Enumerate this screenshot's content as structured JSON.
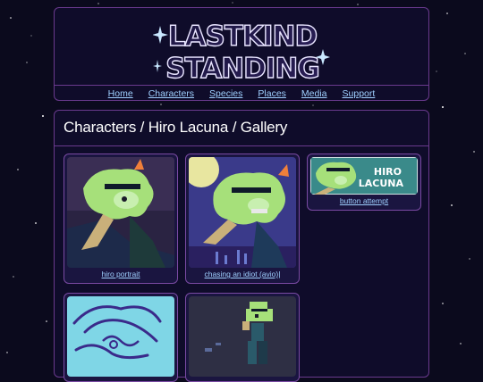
{
  "site": {
    "logo_text_line1": "LASTKIND",
    "logo_text_line2": "STANDING"
  },
  "nav": {
    "items": [
      "Home",
      "Characters",
      "Species",
      "Places",
      "Media",
      "Support"
    ]
  },
  "page": {
    "title": "Characters / Hiro Lacuna / Gallery"
  },
  "gallery": [
    {
      "caption": "hiro portrait"
    },
    {
      "caption": "chasing an idiot (avio)|"
    },
    {
      "caption": "button attempt",
      "button_text_line1": "HIRO",
      "button_text_line2": "LACUNA"
    },
    {
      "caption": ""
    },
    {
      "caption": ""
    }
  ],
  "colors": {
    "background": "#0b0a1d",
    "panel": "#0f0c2a",
    "border": "#6a3a8e",
    "link": "#9fd0ff",
    "accent_teal": "#5fd6c4"
  }
}
